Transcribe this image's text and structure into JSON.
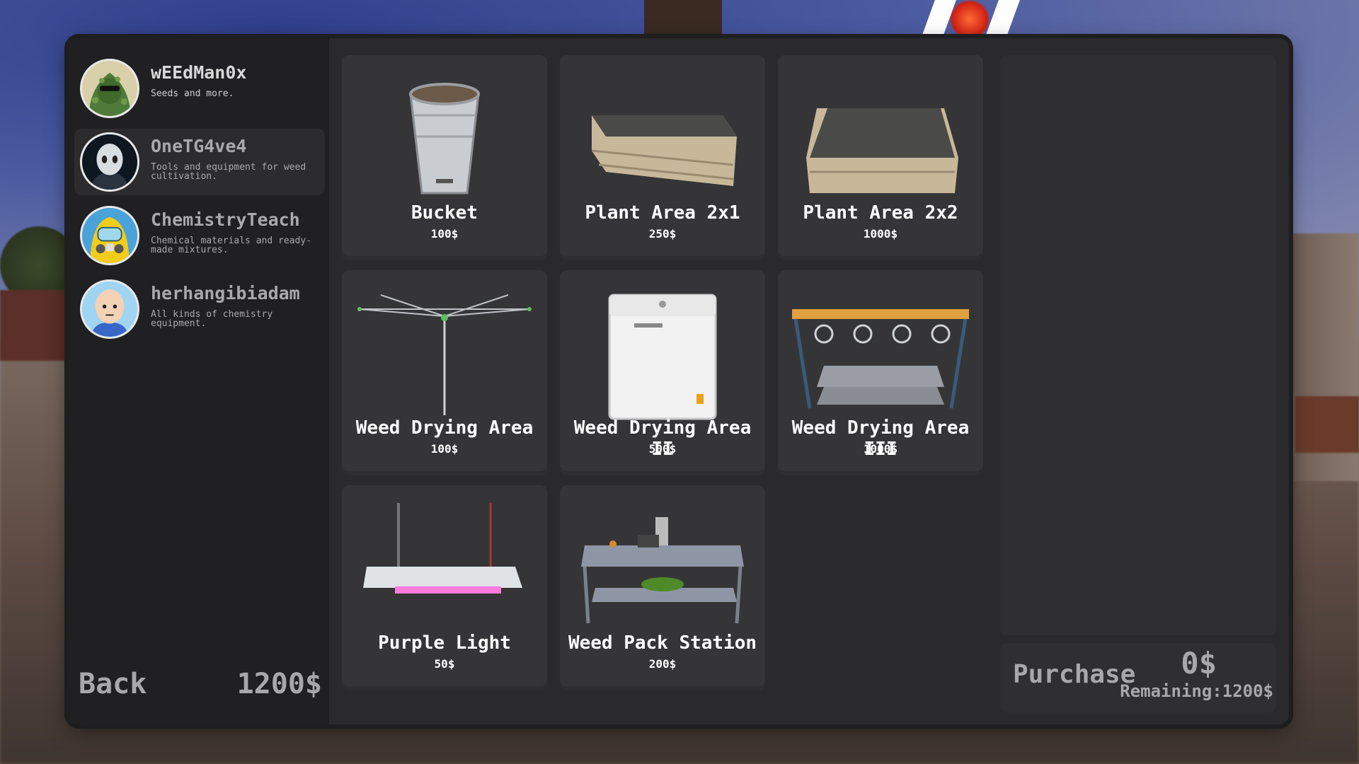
{
  "sidebar": {
    "contacts": [
      {
        "name": "wEEdMan0x",
        "desc": "Seeds and more.",
        "avatar_icon": "green-hooded-avatar-icon"
      },
      {
        "name": "OneTG4ve4",
        "desc": "Tools and equipment for weed cultivation.",
        "avatar_icon": "robot-avatar-icon"
      },
      {
        "name": "ChemistryTeach",
        "desc": "Chemical materials and ready-made mixtures.",
        "avatar_icon": "hazmat-avatar-icon"
      },
      {
        "name": "herhangibiadam",
        "desc": "All kinds of chemistry equipment.",
        "avatar_icon": "bald-man-avatar-icon"
      }
    ],
    "back_label": "Back",
    "balance": "1200$"
  },
  "shop": {
    "items": [
      {
        "title": "Bucket",
        "price": "100$",
        "icon": "bucket-icon"
      },
      {
        "title": "Plant Area 2x1",
        "price": "250$",
        "icon": "planter-box-icon"
      },
      {
        "title": "Plant Area 2x2",
        "price": "1000$",
        "icon": "planter-box-large-icon"
      },
      {
        "title": "Weed Drying Area",
        "price": "100$",
        "icon": "rotary-clothesline-icon"
      },
      {
        "title": "Weed Drying Area II",
        "price": "500$",
        "icon": "white-cabinet-icon"
      },
      {
        "title": "Weed Drying Area III",
        "price": "1000$",
        "icon": "drying-rack-icon"
      },
      {
        "title": "Purple Light",
        "price": "50$",
        "icon": "grow-light-icon"
      },
      {
        "title": "Weed Pack Station",
        "price": "200$",
        "icon": "pack-table-icon"
      }
    ]
  },
  "checkout": {
    "purchase_label": "Purchase",
    "total": "0$",
    "remaining": "Remaining:1200$"
  },
  "colors": {
    "panel": "#2a2a2d",
    "sidebar": "#202022",
    "card": "#353537",
    "muted_text": "#a8a8ab"
  }
}
